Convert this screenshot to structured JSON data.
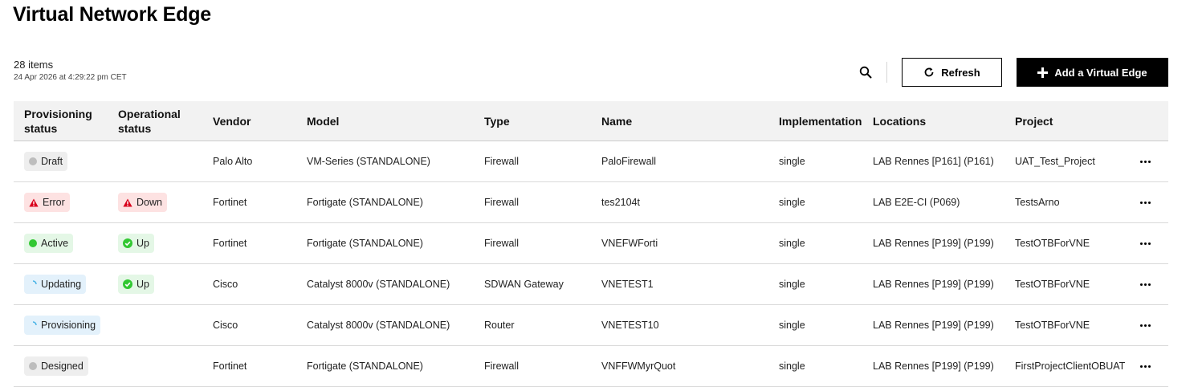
{
  "page": {
    "title": "Virtual Network Edge",
    "items_count": "28 items",
    "timestamp": "24 Apr 2026 at 4:29:22 pm CET"
  },
  "toolbar": {
    "refresh_label": "Refresh",
    "add_label": "Add a Virtual Edge"
  },
  "table": {
    "columns": {
      "provisioning_status": "Provisioning status",
      "operational_status": "Operational status",
      "vendor": "Vendor",
      "model": "Model",
      "type": "Type",
      "name": "Name",
      "implementation": "Implementation",
      "locations": "Locations",
      "project": "Project"
    },
    "rows": [
      {
        "provisioning": "Draft",
        "operational": "",
        "vendor": "Palo Alto",
        "model": "VM-Series (STANDALONE)",
        "type": "Firewall",
        "name": "PaloFirewall",
        "implementation": "single",
        "location": "LAB Rennes [P161] (P161)",
        "project": "UAT_Test_Project"
      },
      {
        "provisioning": "Error",
        "operational": "Down",
        "vendor": "Fortinet",
        "model": "Fortigate (STANDALONE)",
        "type": "Firewall",
        "name": "tes2104t",
        "implementation": "single",
        "location": "LAB E2E-CI (P069)",
        "project": "TestsArno"
      },
      {
        "provisioning": "Active",
        "operational": "Up",
        "vendor": "Fortinet",
        "model": "Fortigate (STANDALONE)",
        "type": "Firewall",
        "name": "VNEFWForti",
        "implementation": "single",
        "location": "LAB Rennes [P199] (P199)",
        "project": "TestOTBForVNE"
      },
      {
        "provisioning": "Updating",
        "operational": "Up",
        "vendor": "Cisco",
        "model": "Catalyst 8000v (STANDALONE)",
        "type": "SDWAN Gateway",
        "name": "VNETEST1",
        "implementation": "single",
        "location": "LAB Rennes [P199] (P199)",
        "project": "TestOTBForVNE"
      },
      {
        "provisioning": "Provisioning",
        "operational": "",
        "vendor": "Cisco",
        "model": "Catalyst 8000v (STANDALONE)",
        "type": "Router",
        "name": "VNETEST10",
        "implementation": "single",
        "location": "LAB Rennes [P199] (P199)",
        "project": "TestOTBForVNE"
      },
      {
        "provisioning": "Designed",
        "operational": "",
        "vendor": "Fortinet",
        "model": "Fortigate (STANDALONE)",
        "type": "Firewall",
        "name": "VNFFWMyrQuot",
        "implementation": "single",
        "location": "LAB Rennes [P199] (P199)",
        "project": "FirstProjectClientOBUAT"
      }
    ]
  },
  "status_styles": {
    "Draft": {
      "tone": "grey",
      "icon": "grey-dot-icon",
      "bg": "#eeeeee"
    },
    "Designed": {
      "tone": "grey",
      "icon": "grey-dot-icon",
      "bg": "#eeeeee"
    },
    "Error": {
      "tone": "red",
      "icon": "warning-triangle-icon",
      "bg": "#fde2e2",
      "accent": "#d9001b"
    },
    "Down": {
      "tone": "red",
      "icon": "warning-triangle-icon",
      "bg": "#fde2e2",
      "accent": "#d9001b"
    },
    "Active": {
      "tone": "green",
      "icon": "green-dot-icon",
      "bg": "#e4f7e6",
      "accent": "#32c832"
    },
    "Up": {
      "tone": "green",
      "icon": "check-circle-icon",
      "bg": "#e4f7e6",
      "accent": "#32c832"
    },
    "Updating": {
      "tone": "blue",
      "icon": "spinner-icon",
      "bg": "#e3f1fb",
      "accent": "#4bb4e6"
    },
    "Provisioning": {
      "tone": "blue",
      "icon": "spinner-icon",
      "bg": "#e3f1fb",
      "accent": "#4bb4e6"
    }
  }
}
